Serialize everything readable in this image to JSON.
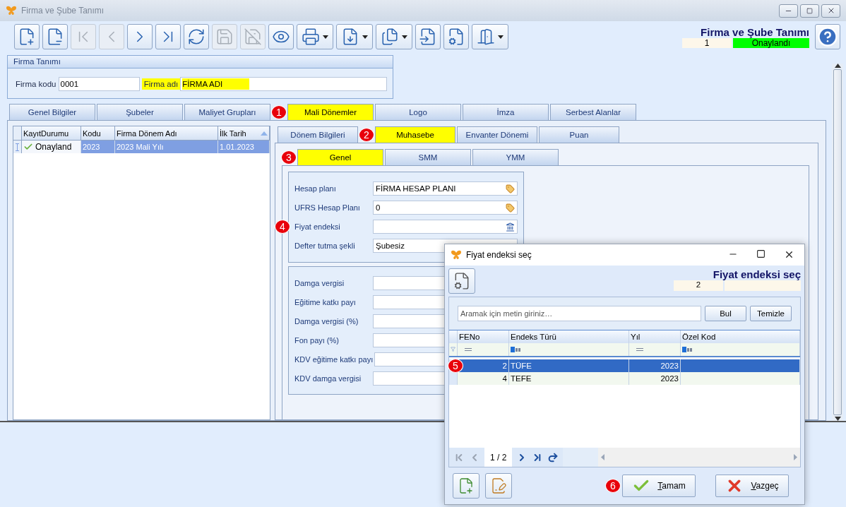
{
  "window": {
    "title": "Firma ve Şube Tanımı"
  },
  "toolbar": [
    {
      "kind": "new",
      "disabled": false,
      "dropdown": false
    },
    {
      "kind": "delete",
      "disabled": false,
      "dropdown": false
    },
    {
      "kind": "first",
      "disabled": true,
      "dropdown": false
    },
    {
      "kind": "previous",
      "disabled": true,
      "dropdown": false
    },
    {
      "kind": "next",
      "disabled": false,
      "dropdown": false
    },
    {
      "kind": "last",
      "disabled": false,
      "dropdown": false
    },
    {
      "kind": "refresh",
      "disabled": false,
      "dropdown": false
    },
    {
      "kind": "save",
      "disabled": true,
      "dropdown": false
    },
    {
      "kind": "discard",
      "disabled": true,
      "dropdown": false
    },
    {
      "kind": "preview",
      "disabled": false,
      "dropdown": false
    },
    {
      "kind": "print",
      "disabled": false,
      "dropdown": true
    },
    {
      "kind": "pdf",
      "disabled": false,
      "dropdown": true
    },
    {
      "kind": "copy",
      "disabled": false,
      "dropdown": true
    },
    {
      "kind": "import",
      "disabled": false,
      "dropdown": false
    },
    {
      "kind": "tools",
      "disabled": false,
      "dropdown": false
    },
    {
      "kind": "exit",
      "disabled": false,
      "dropdown": true
    }
  ],
  "header": {
    "title": "Firma ve Şube Tanımı",
    "record": "1",
    "status": {
      "label": "Onaylandı",
      "color": "#00ff00"
    }
  },
  "firm_panel": {
    "title": "Firma Tanımı",
    "fields": [
      {
        "label": "Firma kodu",
        "value": "0001",
        "highlighted": false
      },
      {
        "label": "Firma adı",
        "value": "FİRMA ADI",
        "highlighted": true
      }
    ]
  },
  "main_tabs": [
    {
      "label": "Genel Bilgiler",
      "selected": false
    },
    {
      "label": "Şubeler",
      "selected": false
    },
    {
      "label": "Maliyet Grupları",
      "selected": false
    },
    {
      "label": "Mali Dönemler",
      "selected": true,
      "badge": "1"
    },
    {
      "label": "Logo",
      "selected": false
    },
    {
      "label": "İmza",
      "selected": false
    },
    {
      "label": "Serbest Alanlar",
      "selected": false
    }
  ],
  "periods": {
    "columns": [
      {
        "label": "KayıtDurumu",
        "sorted": false
      },
      {
        "label": "Kodu",
        "sorted": false
      },
      {
        "label": "Firma Dönem Adı",
        "sorted": false
      },
      {
        "label": "İlk Tarih",
        "sorted": true
      }
    ],
    "rows": [
      {
        "selected": true,
        "approved": true,
        "cells": [
          "Onayland",
          "2023",
          "2023 Mali Yılı",
          "1.01.2023"
        ]
      }
    ]
  },
  "sub_tabs": [
    {
      "label": "Dönem Bilgileri",
      "selected": false
    },
    {
      "label": "Muhasebe",
      "selected": true,
      "badge": "2"
    },
    {
      "label": "Envanter Dönemi",
      "selected": false
    },
    {
      "label": "Puan",
      "selected": false
    }
  ],
  "inner_tabs": [
    {
      "label": "Genel",
      "selected": true,
      "badge": "3"
    },
    {
      "label": "SMM",
      "selected": false
    },
    {
      "label": "YMM",
      "selected": false
    }
  ],
  "account_fields": [
    {
      "label": "Hesap planı",
      "value": "FİRMA HESAP PLANI",
      "kind": "lookup"
    },
    {
      "label": "UFRS Hesap Planı",
      "value": "0",
      "kind": "lookup"
    },
    {
      "label": "Fiyat endeksi",
      "kind": "index",
      "badge": "4"
    },
    {
      "label": "Defter tutma şekli",
      "value": "Şubesiz",
      "kind": "select"
    }
  ],
  "tax_fields": [
    {
      "label": "Damga vergisi"
    },
    {
      "label": "Eğitime katkı payı"
    },
    {
      "label": "Damga vergisi (%)"
    },
    {
      "label": "Fon payı (%)"
    },
    {
      "label": "KDV eğitime katkı payı"
    },
    {
      "label": "KDV damga vergisi"
    }
  ],
  "dialog": {
    "title": "Fiyat endeksi seç",
    "header_title": "Fiyat endeksi seç",
    "count": "2",
    "search": {
      "placeholder": "Aramak için metin giriniz…"
    },
    "search_buttons": [
      "Bul",
      "Temizle"
    ],
    "columns": [
      "FENo",
      "Endeks Türü",
      "Yıl",
      "Özel Kod"
    ],
    "rows": [
      {
        "cells": [
          "2",
          "TÜFE",
          "2023"
        ],
        "selected": true,
        "badge": "5"
      },
      {
        "cells": [
          "4",
          "TEFE",
          "2023"
        ],
        "selected": false
      }
    ],
    "pager": "1 / 2",
    "ok": {
      "label": "Tamam",
      "badge": "6"
    },
    "cancel": {
      "label": "Vazgeç"
    }
  }
}
